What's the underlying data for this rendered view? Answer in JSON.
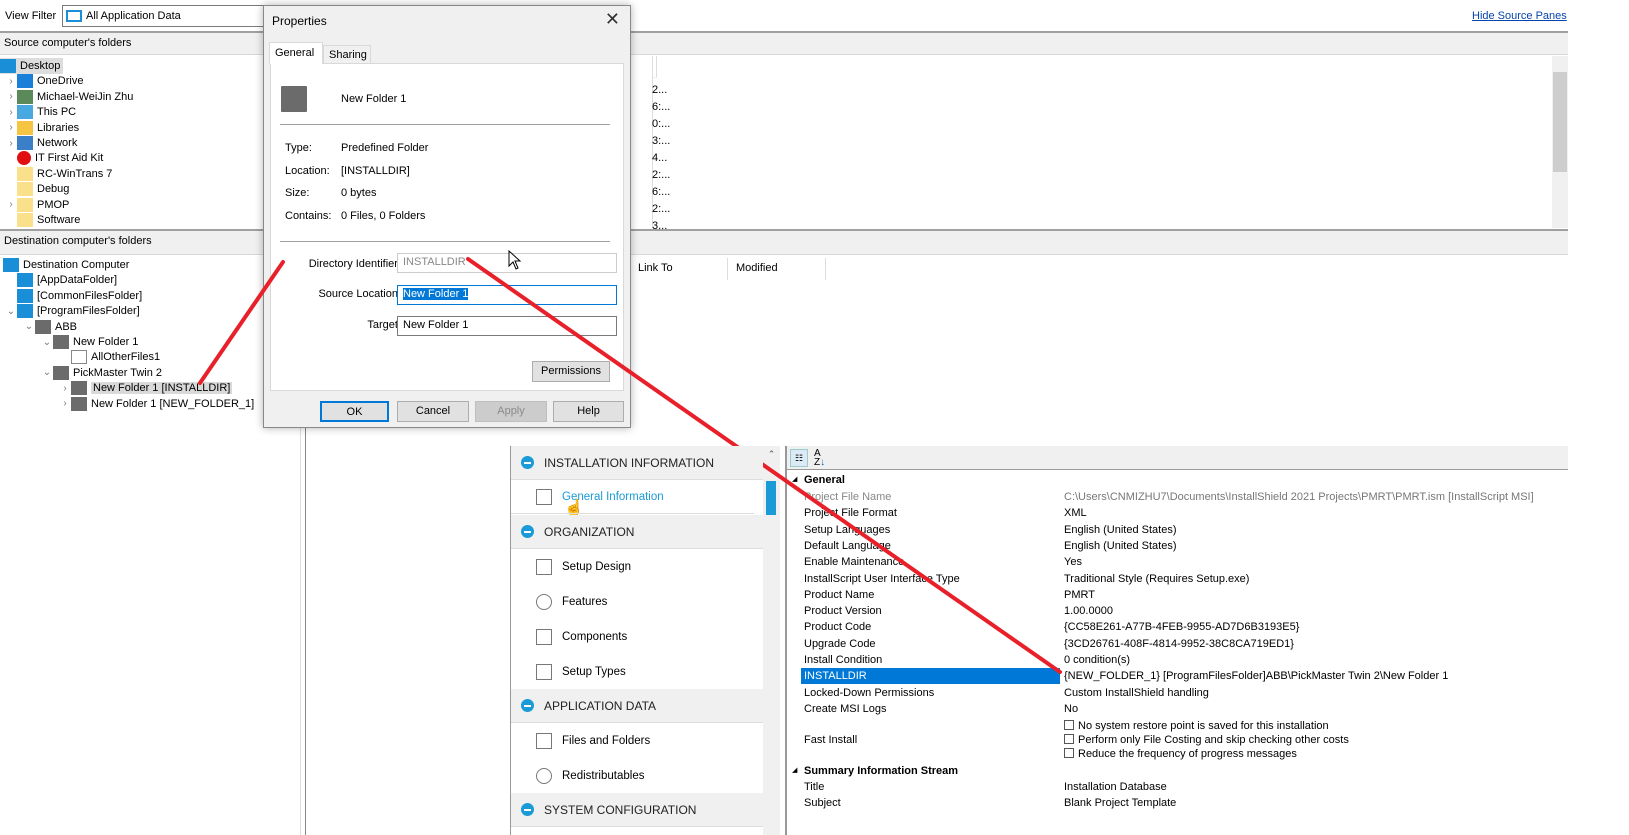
{
  "toolbar": {
    "view_filter_label": "View Filter",
    "view_filter_value": "All Application Data",
    "hide_source_panes": "Hide Source Panes"
  },
  "source": {
    "header": "Source computer's folders",
    "tree": [
      {
        "label": "Desktop",
        "icon": "desktop-icon"
      },
      {
        "label": "OneDrive",
        "icon": "cloud-icon"
      },
      {
        "label": "Michael-WeiJin Zhu",
        "icon": "user-icon"
      },
      {
        "label": "This PC",
        "icon": "computer-icon"
      },
      {
        "label": "Libraries",
        "icon": "library-icon"
      },
      {
        "label": "Network",
        "icon": "network-icon"
      },
      {
        "label": "IT First Aid Kit",
        "icon": "first-aid-icon"
      },
      {
        "label": "RC-WinTrans 7",
        "icon": "folder-icon"
      },
      {
        "label": "Debug",
        "icon": "folder-icon"
      },
      {
        "label": "PMOP",
        "icon": "folder-icon"
      },
      {
        "label": "Software",
        "icon": "folder-icon"
      }
    ],
    "list_values": [
      "2...",
      "6:...",
      "0:...",
      "3:...",
      "4...",
      "2:...",
      "6:...",
      "2:...",
      "3..."
    ]
  },
  "destination": {
    "header": "Destination computer's folders",
    "tree": [
      {
        "label": "Destination Computer"
      },
      {
        "label": "[AppDataFolder]"
      },
      {
        "label": "[CommonFilesFolder]"
      },
      {
        "label": "[ProgramFilesFolder]"
      },
      {
        "label": "ABB"
      },
      {
        "label": "New Folder 1"
      },
      {
        "label": "AllOtherFiles1"
      },
      {
        "label": "PickMaster Twin 2"
      },
      {
        "label": "New Folder 1 [INSTALLDIR]"
      },
      {
        "label": "New Folder 1 [NEW_FOLDER_1]"
      }
    ],
    "columns": [
      "Link To",
      "Modified"
    ]
  },
  "dialog": {
    "title": "Properties",
    "tabs": [
      "General",
      "Sharing"
    ],
    "folder_name": "New Folder 1",
    "info": [
      {
        "label": "Type:",
        "value": "Predefined Folder"
      },
      {
        "label": "Location:",
        "value": "[INSTALLDIR]"
      },
      {
        "label": "Size:",
        "value": "0 bytes"
      },
      {
        "label": "Contains:",
        "value": "0 Files, 0 Folders"
      }
    ],
    "directory_identifier_label": "Directory Identifier:",
    "directory_identifier": "INSTALLDIR",
    "source_location_label": "Source Location:",
    "source_location": "New Folder 1",
    "target_label": "Target:",
    "target": "New Folder 1",
    "permissions": "Permissions",
    "ok": "OK",
    "cancel": "Cancel",
    "apply": "Apply",
    "help": "Help"
  },
  "nav": {
    "sections": [
      {
        "title": "INSTALLATION INFORMATION",
        "items": [
          {
            "label": "General Information",
            "icon": "window-icon",
            "active": true
          }
        ]
      },
      {
        "title": "ORGANIZATION",
        "items": [
          {
            "label": "Setup Design",
            "icon": "setup-design-icon"
          },
          {
            "label": "Features",
            "icon": "features-icon"
          },
          {
            "label": "Components",
            "icon": "components-icon"
          },
          {
            "label": "Setup Types",
            "icon": "gift-icon"
          }
        ]
      },
      {
        "title": "APPLICATION DATA",
        "items": [
          {
            "label": "Files and Folders",
            "icon": "files-icon"
          },
          {
            "label": "Redistributables",
            "icon": "refresh-icon"
          }
        ]
      },
      {
        "title": "SYSTEM CONFIGURATION",
        "items": []
      }
    ]
  },
  "props": {
    "general_header": "General",
    "rows": [
      {
        "name": "Project File Name",
        "value": "C:\\Users\\CNMIZHU7\\Documents\\InstallShield 2021 Projects\\PMRT\\PMRT.ism [InstallScript MSI]"
      },
      {
        "name": "Project File Format",
        "value": "XML"
      },
      {
        "name": "Setup Languages",
        "value": "English (United States)"
      },
      {
        "name": "Default Language",
        "value": "English (United States)"
      },
      {
        "name": "Enable Maintenance",
        "value": "Yes"
      },
      {
        "name": "InstallScript User Interface Type",
        "value": "Traditional Style (Requires Setup.exe)"
      },
      {
        "name": "Product Name",
        "value": "PMRT"
      },
      {
        "name": "Product Version",
        "value": "1.00.0000"
      },
      {
        "name": "Product Code",
        "value": "{CC58E261-A77B-4FEB-9955-AD7D6B3193E5}"
      },
      {
        "name": "Upgrade Code",
        "value": "{3CD26761-408F-4814-9952-38C8CA719ED1}"
      },
      {
        "name": "Install Condition",
        "value": "0 condition(s)"
      },
      {
        "name": "INSTALLDIR",
        "value": "{NEW_FOLDER_1} [ProgramFilesFolder]ABB\\PickMaster Twin 2\\New Folder 1"
      },
      {
        "name": "Locked-Down Permissions",
        "value": "Custom InstallShield handling"
      },
      {
        "name": "Create MSI Logs",
        "value": "No"
      }
    ],
    "fast_install_label": "Fast Install",
    "fast_install_options": [
      "No system restore point is saved for this installation",
      "Perform only File Costing and skip checking other costs",
      "Reduce the frequency of progress messages"
    ],
    "summary_header": "Summary Information Stream",
    "summary_rows": [
      {
        "name": "Title",
        "value": "Installation Database"
      },
      {
        "name": "Subject",
        "value": "Blank Project Template"
      }
    ]
  },
  "colors": {
    "accent": "#0078d7",
    "selection": "#0078d7",
    "annotation": "#e8202a",
    "nav_accent": "#1a9ad6"
  }
}
